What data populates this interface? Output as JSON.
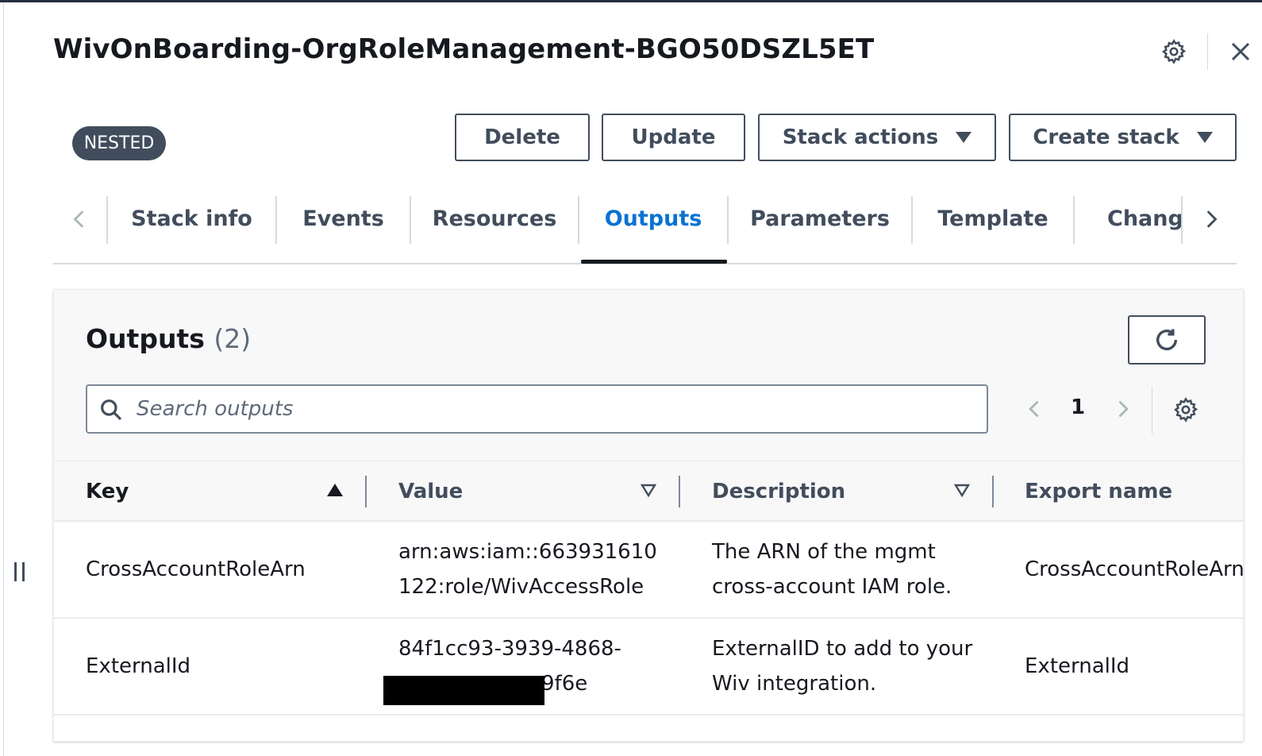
{
  "header": {
    "title": "WivOnBoarding-OrgRoleManagement-BGO50DSZL5ET",
    "badge": "NESTED"
  },
  "actions": {
    "delete": "Delete",
    "update": "Update",
    "stack_actions": "Stack actions",
    "create_stack": "Create stack"
  },
  "tabs": [
    {
      "label": "Stack info"
    },
    {
      "label": "Events"
    },
    {
      "label": "Resources"
    },
    {
      "label": "Outputs",
      "active": true
    },
    {
      "label": "Parameters"
    },
    {
      "label": "Template"
    },
    {
      "label": "Change"
    }
  ],
  "outputs": {
    "title": "Outputs",
    "count": "(2)",
    "search_placeholder": "Search outputs",
    "page": "1",
    "columns": {
      "key": "Key",
      "value": "Value",
      "description": "Description",
      "export_name": "Export name"
    },
    "rows": [
      {
        "key": "CrossAccountRoleArn",
        "value": "arn:aws:iam::663931610 122:role/WivAccessRole",
        "description": "The ARN of the mgmt cross-account IAM role.",
        "export_name": "CrossAccountRoleArn"
      },
      {
        "key": "ExternalId",
        "value": "84f1cc93-3939-4868- 9f6e",
        "description": "ExternalID to add to your Wiv integration.",
        "export_name": "ExternalId"
      }
    ]
  },
  "colors": {
    "accent": "#0972d3",
    "text": "#16191f",
    "secondary": "#414d5c",
    "badge_bg": "#414d5c"
  }
}
